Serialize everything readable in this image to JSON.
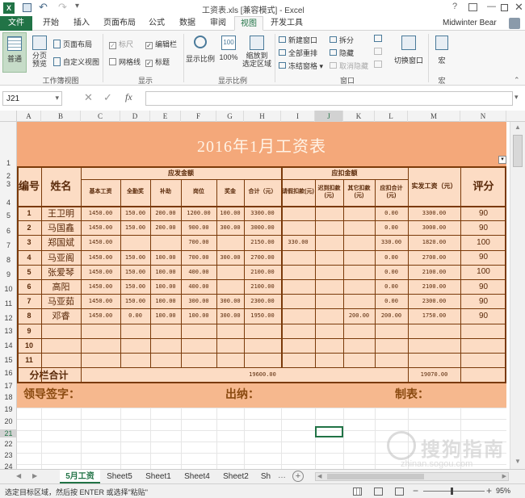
{
  "window": {
    "title": "工资表.xls [兼容模式] - Excel",
    "user": "Midwinter Bear"
  },
  "ribbon_tabs": [
    "文件",
    "开始",
    "插入",
    "页面布局",
    "公式",
    "数据",
    "审阅",
    "视图",
    "开发工具"
  ],
  "ribbon": {
    "normal": "普通",
    "page_break": "分页\n预览",
    "page_layout": "页面布局",
    "custom_views": "自定义视图",
    "group_workbook_views": "工作簿视图",
    "ruler": "标尺",
    "gridlines": "网格线",
    "formula_bar": "编辑栏",
    "headings": "标题",
    "group_show": "显示",
    "zoom": "显示比例",
    "zoom100": "100%",
    "zoom_selection": "缩放到\n选定区域",
    "group_zoom": "显示比例",
    "new_window": "新建窗口",
    "arrange_all": "全部重排",
    "freeze_panes": "冻结窗格",
    "split": "拆分",
    "hide": "隐藏",
    "unhide": "取消隐藏",
    "switch_windows": "切换窗口",
    "group_window": "窗口",
    "macros": "宏",
    "group_macros": "宏"
  },
  "formula_bar": {
    "name_box": "J21",
    "fx": "fx",
    "value": ""
  },
  "columns": [
    "A",
    "B",
    "C",
    "D",
    "E",
    "F",
    "G",
    "H",
    "I",
    "J",
    "K",
    "L",
    "M",
    "N"
  ],
  "rows": [
    "1",
    "2",
    "3",
    "4",
    "5",
    "6",
    "7",
    "8",
    "9",
    "10",
    "11",
    "12",
    "13",
    "14",
    "15",
    "16",
    "17",
    "18",
    "19",
    "20",
    "21",
    "22",
    "23",
    "24"
  ],
  "sheet": {
    "title": "2016年1月工资表",
    "h_no": "编号",
    "h_name": "姓名",
    "h_payable": "应发金额",
    "h_deduct": "应扣金额",
    "h_actual": "实发工资（元）",
    "h_score": "评分",
    "sub": [
      "基本工资",
      "全勤奖",
      "补助",
      "岗位",
      "奖金",
      "合计（元）",
      "请假扣款(元)",
      "迟到扣款(元)",
      "其它扣款(元)",
      "应扣合计(元)"
    ],
    "rows": [
      {
        "no": "1",
        "name": "王卫明",
        "c": "1450.00",
        "d": "150.00",
        "e": "200.00",
        "f": "1200.00",
        "g": "100.00",
        "h": "3300.00",
        "i": "",
        "j": "",
        "k": "",
        "l": "0.00",
        "m": "3300.00",
        "n": "90"
      },
      {
        "no": "2",
        "name": "马国鑫",
        "c": "1450.00",
        "d": "150.00",
        "e": "200.00",
        "f": "900.00",
        "g": "300.00",
        "h": "3000.00",
        "i": "",
        "j": "",
        "k": "",
        "l": "0.00",
        "m": "3000.00",
        "n": "90"
      },
      {
        "no": "3",
        "name": "郑国斌",
        "c": "1450.00",
        "d": "",
        "e": "",
        "f": "700.00",
        "g": "",
        "h": "2150.00",
        "i": "330.00",
        "j": "",
        "k": "",
        "l": "330.00",
        "m": "1820.00",
        "n": "100"
      },
      {
        "no": "4",
        "name": "马亚阁",
        "c": "1450.00",
        "d": "150.00",
        "e": "100.00",
        "f": "700.00",
        "g": "300.00",
        "h": "2700.00",
        "i": "",
        "j": "",
        "k": "",
        "l": "0.00",
        "m": "2700.00",
        "n": "90"
      },
      {
        "no": "5",
        "name": "张爱琴",
        "c": "1450.00",
        "d": "150.00",
        "e": "100.00",
        "f": "400.00",
        "g": "",
        "h": "2100.00",
        "i": "",
        "j": "",
        "k": "",
        "l": "0.00",
        "m": "2100.00",
        "n": "100"
      },
      {
        "no": "6",
        "name": "高阳",
        "c": "1450.00",
        "d": "150.00",
        "e": "100.00",
        "f": "400.00",
        "g": "",
        "h": "2100.00",
        "i": "",
        "j": "",
        "k": "",
        "l": "0.00",
        "m": "2100.00",
        "n": "90"
      },
      {
        "no": "7",
        "name": "马亚茹",
        "c": "1450.00",
        "d": "150.00",
        "e": "100.00",
        "f": "300.00",
        "g": "300.00",
        "h": "2300.00",
        "i": "",
        "j": "",
        "k": "",
        "l": "0.00",
        "m": "2300.00",
        "n": "90"
      },
      {
        "no": "8",
        "name": "邓睿",
        "c": "1450.00",
        "d": "0.00",
        "e": "100.00",
        "f": "100.00",
        "g": "300.00",
        "h": "1950.00",
        "i": "",
        "j": "",
        "k": "200.00",
        "l": "200.00",
        "m": "1750.00",
        "n": "90"
      },
      {
        "no": "9",
        "name": "",
        "c": "",
        "d": "",
        "e": "",
        "f": "",
        "g": "",
        "h": "",
        "i": "",
        "j": "",
        "k": "",
        "l": "",
        "m": "",
        "n": ""
      },
      {
        "no": "10",
        "name": "",
        "c": "",
        "d": "",
        "e": "",
        "f": "",
        "g": "",
        "h": "",
        "i": "",
        "j": "",
        "k": "",
        "l": "",
        "m": "",
        "n": ""
      },
      {
        "no": "11",
        "name": "",
        "c": "",
        "d": "",
        "e": "",
        "f": "",
        "g": "",
        "h": "",
        "i": "",
        "j": "",
        "k": "",
        "l": "",
        "m": "",
        "n": ""
      }
    ],
    "total_label": "分栏合计",
    "total_h": "19600.00",
    "total_m": "19070.00",
    "sig_leader": "领导签字：",
    "sig_cashier": "出纳：",
    "sig_maker": "制表："
  },
  "sheet_tabs": [
    "5月工资",
    "Sheet5",
    "Sheet1",
    "Sheet4",
    "Sheet2",
    "Sh"
  ],
  "status": {
    "text": "选定目标区域，然后按 ENTER 或选择\"粘贴\"",
    "zoom": "95%"
  },
  "watermark": {
    "text": "搜狗指南",
    "sub": "zhinan.sogou.com"
  },
  "colors": {
    "excel_green": "#217346",
    "sheet_fill": "#fcdcc4",
    "title_fill": "#f4a87a"
  }
}
